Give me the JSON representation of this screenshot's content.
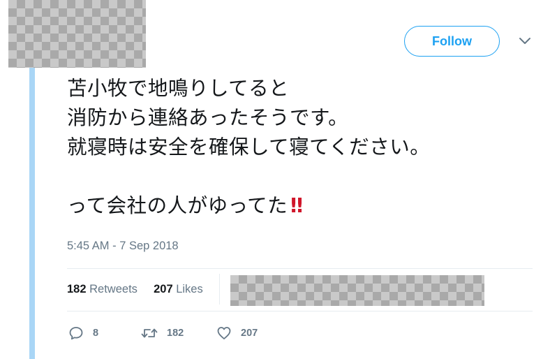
{
  "tweet": {
    "follow_label": "Follow",
    "text_lines": [
      "苫小牧で地鳴りしてると",
      "消防から連絡あったそうです。",
      "就寝時は安全を確保して寝てください。",
      "",
      "って会社の人がゆってた"
    ],
    "emoji": "‼",
    "timestamp": "5:45 AM - 7 Sep 2018",
    "stats": {
      "retweets_count": "182",
      "retweets_label": "Retweets",
      "likes_count": "207",
      "likes_label": "Likes"
    },
    "actions": {
      "reply_count": "8",
      "retweet_count": "182",
      "like_count": "207"
    }
  },
  "icons": {
    "menu": "chevron-down-icon",
    "reply": "reply-icon",
    "retweet": "retweet-icon",
    "like": "heart-icon"
  },
  "colors": {
    "accent": "#1da1f2",
    "thread_line": "#a9d6f6",
    "muted_text": "#657786",
    "emoji_red": "#d0162a"
  }
}
